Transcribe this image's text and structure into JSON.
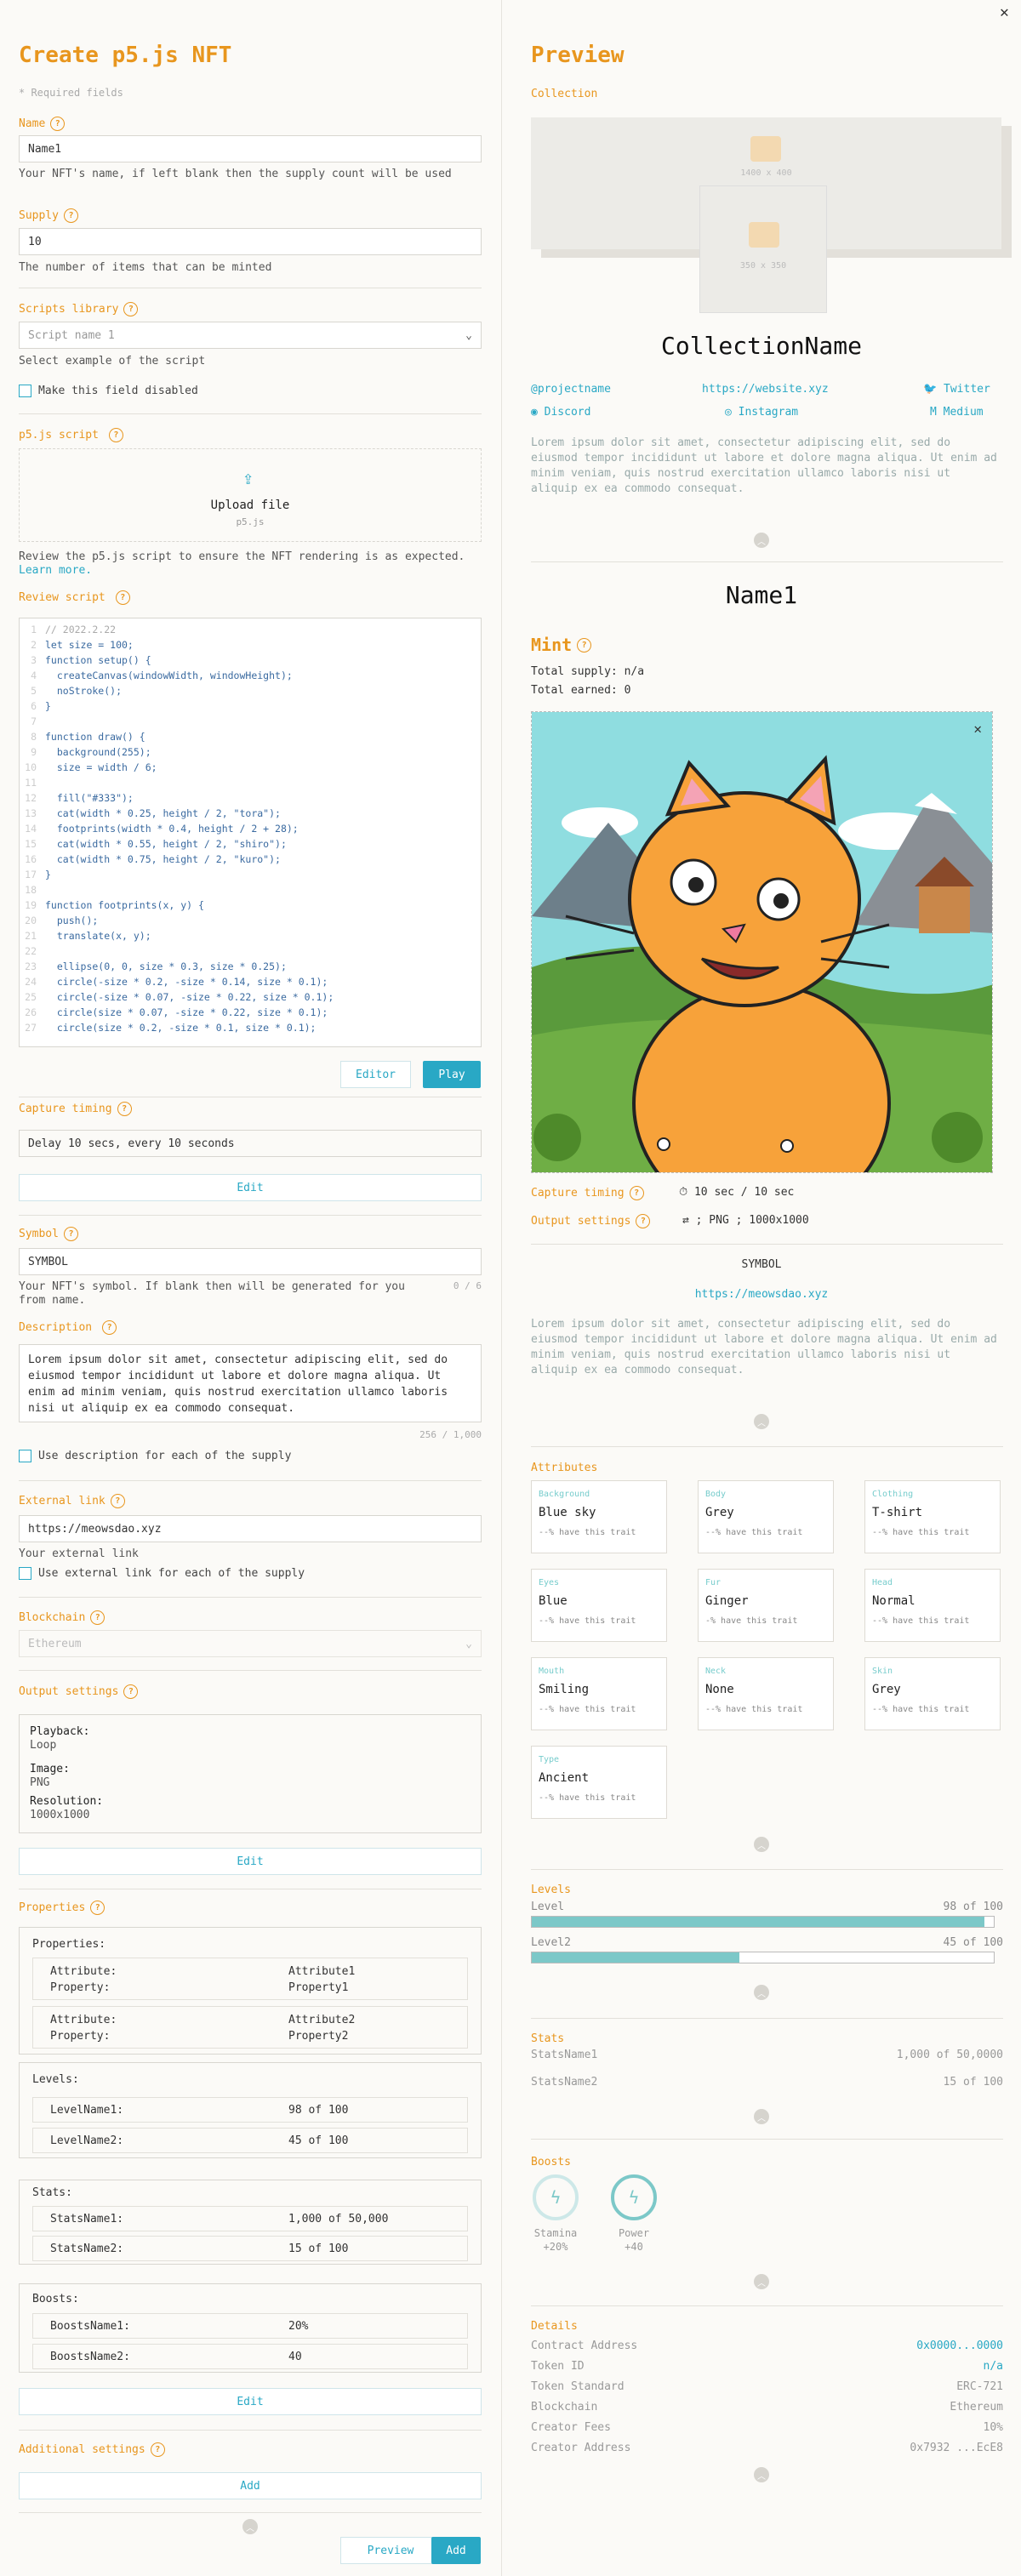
{
  "form": {
    "title": "Create p5.js NFT",
    "required_note": "* Required fields",
    "name_label": "Name",
    "name_value": "Name1",
    "name_help": "Your NFT's name, if left blank then the supply count will be used",
    "supply_label": "Supply",
    "supply_value": "10",
    "supply_help": "The number of items that can be minted",
    "scripts_label": "Scripts library",
    "scripts_placeholder": "Script name 1",
    "scripts_help": "Select example of the script",
    "disable_label": "Make this field disabled",
    "p5_label": "p5.js script",
    "upload_label": "Upload file",
    "upload_sub": "p5.js",
    "review_help": "Review the p5.js script to ensure the NFT rendering is as expected.",
    "learn_more": "Learn more.",
    "review_label": "Review script",
    "code_lines": [
      "// 2022.2.22",
      "let size = 100;",
      "function setup() {",
      "  createCanvas(windowWidth, windowHeight);",
      "  noStroke();",
      "}",
      "",
      "function draw() {",
      "  background(255);",
      "  size = width / 6;",
      "",
      "  fill(\"#333\");",
      "  cat(width * 0.25, height / 2, \"tora\");",
      "  footprints(width * 0.4, height / 2 + 28);",
      "  cat(width * 0.55, height / 2, \"shiro\");",
      "  cat(width * 0.75, height / 2, \"kuro\");",
      "}",
      "",
      "function footprints(x, y) {",
      "  push();",
      "  translate(x, y);",
      "",
      "  ellipse(0, 0, size * 0.3, size * 0.25);",
      "  circle(-size * 0.2, -size * 0.14, size * 0.1);",
      "  circle(-size * 0.07, -size * 0.22, size * 0.1);",
      "  circle(size * 0.07, -size * 0.22, size * 0.1);",
      "  circle(size * 0.2, -size * 0.1, size * 0.1);"
    ],
    "editor_btn": "Editor",
    "play_btn": "Play",
    "capture_label": "Capture timing",
    "capture_value": "Delay 10 secs, every 10 seconds",
    "edit_btn": "Edit",
    "symbol_label": "Symbol",
    "symbol_value": "SYMBOL",
    "symbol_help": "Your NFT's symbol. If blank then will be generated for you from name.",
    "symbol_count": "0 / 6",
    "desc_label": "Description",
    "desc_value": "Lorem ipsum dolor sit amet, consectetur adipiscing elit, sed do eiusmod tempor incididunt ut labore et dolore magna aliqua. Ut enim ad minim veniam, quis nostrud exercitation ullamco laboris nisi ut aliquip ex ea commodo consequat.",
    "desc_count": "256 / 1,000",
    "desc_each": "Use description for each of the supply",
    "ext_label": "External link",
    "ext_value": "https://meowsdao.xyz",
    "ext_help": "Your external link",
    "ext_each": "Use external link for each of the supply",
    "chain_label": "Blockchain",
    "chain_value": "Ethereum",
    "output_label": "Output settings",
    "playback_k": "Playback:",
    "playback_v": "Loop",
    "image_k": "Image:",
    "image_v": "PNG",
    "res_k": "Resolution:",
    "res_v": "1000x1000",
    "props_label": "Properties",
    "props_title": "Properties:",
    "props": [
      {
        "ak": "Attribute:",
        "av": "Attribute1",
        "pk": "Property:",
        "pv": "Property1"
      },
      {
        "ak": "Attribute:",
        "av": "Attribute2",
        "pk": "Property:",
        "pv": "Property2"
      }
    ],
    "levels_title": "Levels:",
    "levels": [
      {
        "k": "LevelName1:",
        "v": "98 of 100"
      },
      {
        "k": "LevelName2:",
        "v": "45 of 100"
      }
    ],
    "stats_title": "Stats:",
    "stats": [
      {
        "k": "StatsName1:",
        "v": "1,000 of 50,000"
      },
      {
        "k": "StatsName2:",
        "v": "15 of 100"
      }
    ],
    "boosts_title": "Boosts:",
    "boosts": [
      {
        "k": "BoostsName1:",
        "v": "20%"
      },
      {
        "k": "BoostsName2:",
        "v": "40"
      }
    ],
    "additional_label": "Additional settings",
    "add_btn": "Add",
    "preview_btn": "Preview",
    "submit_btn": "Add"
  },
  "preview": {
    "title": "Preview",
    "collection_label": "Collection",
    "banner_size": "1400 x 400",
    "logo_size": "350 x 350",
    "collection_name": "CollectionName",
    "links": {
      "project": "@projectname",
      "website": "https://website.xyz",
      "twitter": "Twitter",
      "discord": "Discord",
      "instagram": "Instagram",
      "medium": "Medium"
    },
    "lorem": "Lorem ipsum dolor sit amet, consectetur adipiscing elit, sed do eiusmod tempor incididunt ut labore et dolore magna aliqua. Ut enim ad minim veniam, quis nostrud exercitation ullamco laboris nisi ut aliquip ex ea commodo consequat.",
    "nft_name": "Name1",
    "mint_label": "Mint",
    "total_supply": "Total supply: n/a",
    "total_earned": "Total earned: 0",
    "capture_label": "Capture timing",
    "capture_value": "10 sec / 10 sec",
    "output_label": "Output settings",
    "output_value": "; PNG ; 1000x1000",
    "symbol": "SYMBOL",
    "ext_link": "https://meowsdao.xyz",
    "attributes_label": "Attributes",
    "attributes": [
      {
        "t": "Background",
        "v": "Blue sky",
        "p": "--% have this trait"
      },
      {
        "t": "Body",
        "v": "Grey",
        "p": "--% have this trait"
      },
      {
        "t": "Clothing",
        "v": "T-shirt",
        "p": "--% have this trait"
      },
      {
        "t": "Eyes",
        "v": "Blue",
        "p": "--% have this trait"
      },
      {
        "t": "Fur",
        "v": "Ginger",
        "p": "-% have this trait"
      },
      {
        "t": "Head",
        "v": "Normal",
        "p": "--% have this trait"
      },
      {
        "t": "Mouth",
        "v": "Smiling",
        "p": "--% have this trait"
      },
      {
        "t": "Neck",
        "v": "None",
        "p": "--% have this trait"
      },
      {
        "t": "Skin",
        "v": "Grey",
        "p": "--% have this trait"
      },
      {
        "t": "Type",
        "v": "Ancient",
        "p": "--% have this trait"
      }
    ],
    "levels_label": "Levels",
    "levels": [
      {
        "name": "Level",
        "value": "98 of 100",
        "fraction": 0.98
      },
      {
        "name": "Level2",
        "value": "45 of 100",
        "fraction": 0.45
      }
    ],
    "stats_label": "Stats",
    "stats": [
      {
        "name": "StatsName1",
        "value": "1,000 of 50,0000"
      },
      {
        "name": "StatsName2",
        "value": "15 of 100"
      }
    ],
    "boosts_label": "Boosts",
    "boosts": [
      {
        "name": "Stamina",
        "value": "+20%"
      },
      {
        "name": "Power",
        "value": "+40"
      }
    ],
    "details_label": "Details",
    "details": [
      {
        "k": "Contract Address",
        "v": "0x0000...0000"
      },
      {
        "k": "Token ID",
        "v": "n/a"
      },
      {
        "k": "Token Standard",
        "v": "ERC-721"
      },
      {
        "k": "Blockchain",
        "v": "Ethereum"
      },
      {
        "k": "Creator Fees",
        "v": "10%"
      },
      {
        "k": "Creator Address",
        "v": "0x7932 ...EcE8"
      }
    ]
  },
  "colors": {
    "accent": "#e8961e",
    "primary": "#29a8c5"
  }
}
